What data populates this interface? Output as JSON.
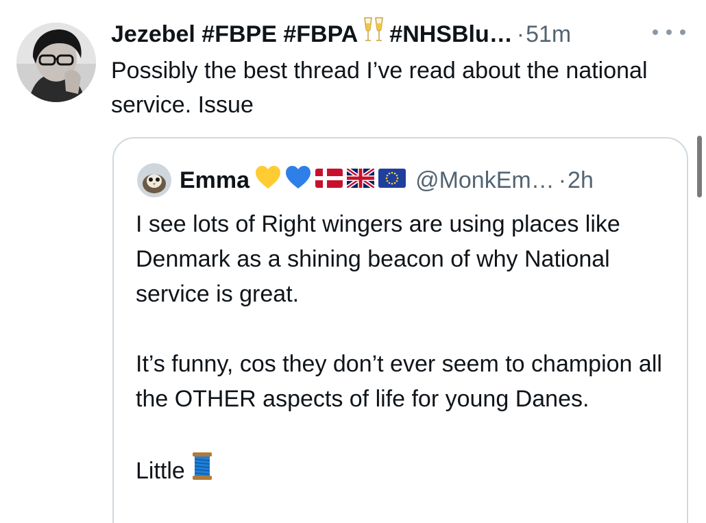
{
  "tweet": {
    "display_name": "Jezebel #FBPE #FBPA",
    "name_suffix": "#NHSBlu…",
    "separator": "·",
    "time": "51m",
    "text": "Possibly the best thread I’ve read about the national service. Issue",
    "icons": {
      "avatar": "profile-photo",
      "name_emoji": "clinking-glasses-icon",
      "more": "more-options-icon"
    }
  },
  "quote": {
    "display_name": "Emma",
    "handle": "@MonkEm…",
    "separator": "·",
    "time": "2h",
    "name_emojis": [
      "yellow-heart-icon",
      "blue-heart-icon",
      "denmark-flag-icon",
      "uk-flag-icon",
      "eu-flag-icon"
    ],
    "paragraphs": [
      "I see lots of Right wingers are using places like Denmark as a shining beacon of why National service is great.",
      "It’s funny, cos they don’t ever seem to champion all the OTHER aspects of life for young Danes.",
      "Little"
    ],
    "trailing_emoji": "spool-of-thread-icon"
  },
  "colors": {
    "text": "#0f1419",
    "secondary": "#536471",
    "border": "#cfd9de",
    "background": "#ffffff"
  }
}
